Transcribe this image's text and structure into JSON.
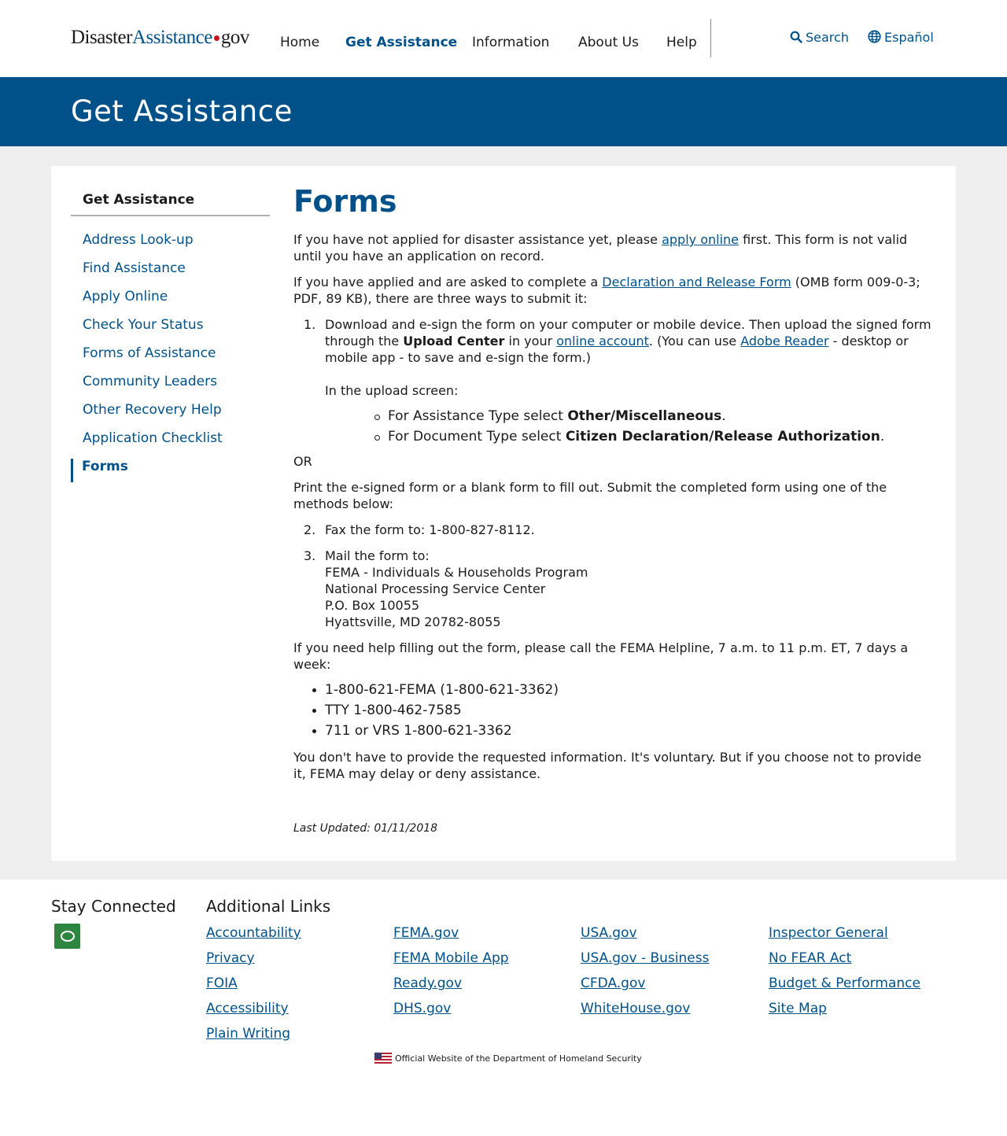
{
  "header": {
    "logo": {
      "part1": "Disaster",
      "part2": "Assistance",
      "part3": "gov"
    },
    "nav": [
      {
        "label": "Home"
      },
      {
        "label": "Get Assistance"
      },
      {
        "label": "Information"
      },
      {
        "label": "About Us"
      },
      {
        "label": "Help"
      }
    ],
    "search_label": "Search",
    "language_label": "Español"
  },
  "banner": {
    "title": "Get Assistance"
  },
  "sidenav": {
    "title": "Get Assistance",
    "items": [
      {
        "label": "Address Look-up"
      },
      {
        "label": "Find Assistance"
      },
      {
        "label": "Apply Online"
      },
      {
        "label": "Check Your Status"
      },
      {
        "label": "Forms of Assistance"
      },
      {
        "label": "Community Leaders"
      },
      {
        "label": "Other Recovery Help"
      },
      {
        "label": "Application Checklist"
      },
      {
        "label": "Forms"
      }
    ]
  },
  "content": {
    "title": "Forms",
    "p1_a": "If you have not applied for disaster assistance yet, please ",
    "p1_link": "apply online",
    "p1_b": " first. This form is not valid until you have an application on record.",
    "p2_a": "If you have applied and are asked to complete a ",
    "p2_link": "Declaration and Release Form",
    "p2_b": " (OMB form 009-0-3; PDF, 89 KB), there are three ways to submit it:",
    "step1_num": "1.",
    "step1_a": "Download and e-sign the form on your computer or mobile device. Then upload the signed form through the ",
    "step1_bold": "Upload Center",
    "step1_b": " in your ",
    "step1_link1": "online account",
    "step1_c": ". (You can use ",
    "step1_link2": "Adobe Reader",
    "step1_d": " - desktop or mobile app - to save and e-sign the form.)",
    "upload_intro": "In the upload screen:",
    "sub1_a": "For Assistance Type select ",
    "sub1_bold": "Other/Miscellaneous",
    "sub2_a": "For Document Type select ",
    "sub2_bold": "Citizen Declaration/Release Authorization",
    "period": ".",
    "or": "OR",
    "print_para": "Print the e-signed form or a blank form to fill out. Submit the completed form using one of the methods below:",
    "step2_num": "2.",
    "step2_text": "Fax the form to: 1-800-827-8112.",
    "step3_num": "3.",
    "step3_lines": [
      "Mail the form to:",
      "FEMA - Individuals & Households Program",
      "National Processing Service Center",
      "P.O. Box 10055",
      "Hyattsville, MD 20782-8055"
    ],
    "help_para": "If you need help filling out the form, please call the FEMA Helpline, 7 a.m. to 11 p.m. ET, 7 days a week:",
    "phones": [
      "1-800-621-FEMA (1-800-621-3362)",
      "TTY 1-800-462-7585",
      "711 or VRS 1-800-621-3362"
    ],
    "voluntary": "You don't have to provide the requested information. It's voluntary. But if you choose not to provide it, FEMA may delay or deny assistance.",
    "last_updated": "Last Updated: 01/11/2018"
  },
  "footer": {
    "stay_connected": "Stay Connected",
    "additional_links": "Additional Links",
    "col1": [
      "Accountability",
      "Privacy",
      "FOIA",
      "Accessibility",
      "Plain Writing"
    ],
    "col2": [
      "FEMA.gov",
      "FEMA Mobile App",
      "Ready.gov",
      "DHS.gov"
    ],
    "col3": [
      "USA.gov",
      "USA.gov - Business",
      "CFDA.gov",
      "WhiteHouse.gov"
    ],
    "col4": [
      "Inspector General",
      "No FEAR Act",
      "Budget & Performance",
      "Site Map"
    ],
    "official": "Official Website of the Department of Homeland Security"
  }
}
